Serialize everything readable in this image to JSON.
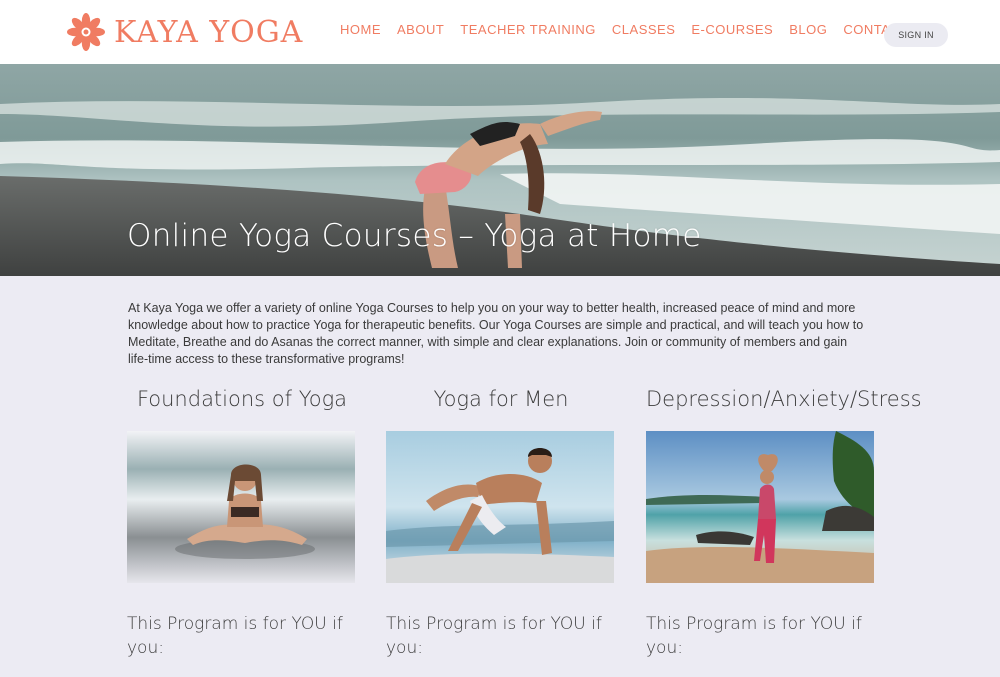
{
  "header": {
    "brand": "KAYA YOGA",
    "nav": [
      "HOME",
      "ABOUT",
      "TEACHER TRAINING",
      "CLASSES",
      "E-COURSES",
      "BLOG",
      "CONTACT"
    ],
    "signin_label": "SIGN IN"
  },
  "hero": {
    "title": "Online Yoga Courses – Yoga at Home"
  },
  "intro": {
    "text": "At Kaya Yoga we offer a variety of online Yoga Courses to help you on your way to better health, increased peace of mind and more knowledge about how to practice Yoga for therapeutic benefits. Our Yoga Courses are simple and practical, and will teach you how to Meditate, Breathe and do Asanas the correct manner, with simple and clear explanations. Join or community of members and gain life-time access to these transformative programs!"
  },
  "courses": [
    {
      "title": "Foundations of Yoga",
      "for_label": "This Program is for YOU if you:"
    },
    {
      "title": "Yoga for Men",
      "for_label": "This Program is for YOU if you:"
    },
    {
      "title": "Depression/Anxiety/Stress",
      "for_label": "This Program is for YOU if you:"
    }
  ],
  "colors": {
    "accent": "#f07c62",
    "page_background": "#ecebf3",
    "header_background": "#ffffff"
  },
  "icons": {
    "logo": "lotus-icon"
  }
}
